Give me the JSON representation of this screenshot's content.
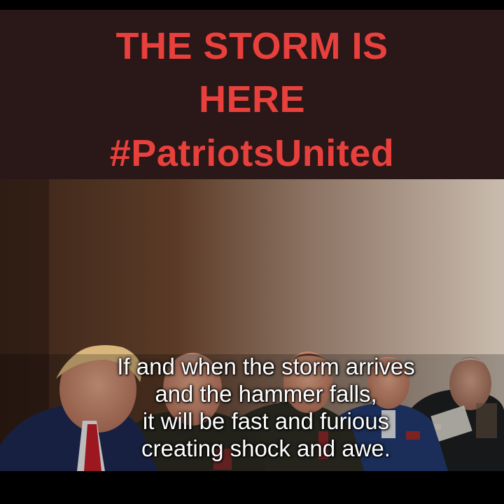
{
  "headline": {
    "line1": "THE STORM IS",
    "line2": "HERE",
    "line3": "#PatriotsUnited",
    "color": "#e8403c"
  },
  "caption": {
    "line1": "If and when the storm arrives",
    "line2": "and the hammer falls,",
    "line3": "it will be fast and furious",
    "line4": "creating shock and awe."
  },
  "colors": {
    "header_bg": "#2a1717",
    "frame": "#000000",
    "caption_text": "#ffffff"
  }
}
